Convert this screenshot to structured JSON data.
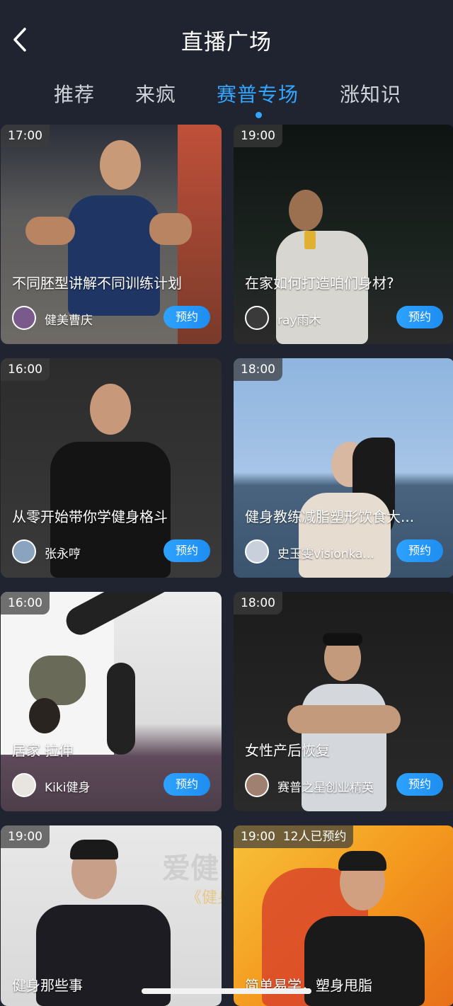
{
  "header": {
    "title": "直播广场",
    "back_icon": "chevron-left-icon",
    "tabs": [
      {
        "label": "推荐",
        "active": false
      },
      {
        "label": "来疯",
        "active": false
      },
      {
        "label": "赛普专场",
        "active": true
      },
      {
        "label": "涨知识",
        "active": false
      }
    ]
  },
  "colors": {
    "accent": "#33a6ff",
    "background": "#1f2430",
    "button": "#2ea2ff"
  },
  "cards": [
    {
      "time": "17:00",
      "title": "不同胚型讲解不同训练计划",
      "author": "健美曹庆",
      "button": "预约"
    },
    {
      "time": "19:00",
      "title": "在家如何打造咱们身材?",
      "author": "ray雨木",
      "button": "预约"
    },
    {
      "time": "16:00",
      "title": "从零开始带你学健身格斗",
      "author": "张永哼",
      "button": "预约"
    },
    {
      "time": "18:00",
      "title": "健身教练减脂塑形饮食大...",
      "author": "史玉雯visionka...",
      "button": "预约"
    },
    {
      "time": "16:00",
      "title": "居家 拉伸",
      "author": "Kiki健身",
      "button": "预约"
    },
    {
      "time": "18:00",
      "title": "女性产后恢复",
      "author": "赛普之星创业精英",
      "button": "预约"
    },
    {
      "time": "19:00",
      "title": "健身那些事",
      "author": "",
      "button": ""
    },
    {
      "time": "19:00  12人已预约",
      "title": "简单易学，塑身甩脂",
      "author": "",
      "button": ""
    }
  ],
  "card6_overlay_text": "爱健",
  "card6_overlay_sub": "《健身"
}
